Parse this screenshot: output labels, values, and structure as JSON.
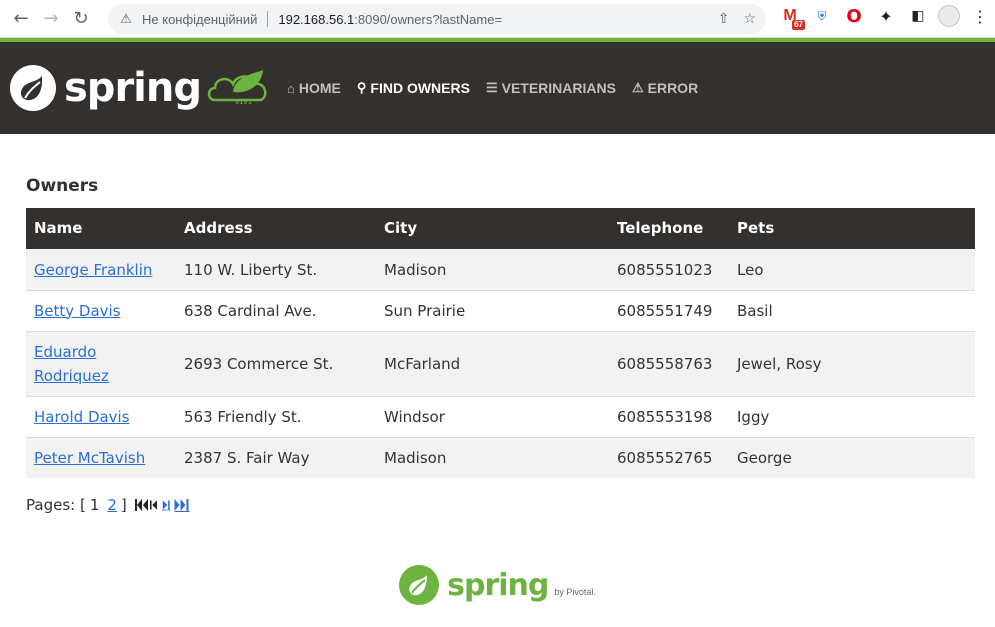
{
  "browser": {
    "security_label": "Не конфіденційний",
    "url_host": "192.168.56.1",
    "url_rest": ":8090/owners?lastName=",
    "gmail_badge": "67"
  },
  "navbar": {
    "brand": "spring",
    "leaf_label": "0101",
    "links": [
      {
        "label": "HOME",
        "icon": "home-icon",
        "active": false
      },
      {
        "label": "FIND OWNERS",
        "icon": "search-icon",
        "active": true
      },
      {
        "label": "VETERINARIANS",
        "icon": "list-icon",
        "active": false
      },
      {
        "label": "ERROR",
        "icon": "warning-icon",
        "active": false
      }
    ]
  },
  "main": {
    "title": "Owners",
    "columns": [
      "Name",
      "Address",
      "City",
      "Telephone",
      "Pets"
    ],
    "rows": [
      {
        "name": "George Franklin",
        "address": "110 W. Liberty St.",
        "city": "Madison",
        "telephone": "6085551023",
        "pets": "Leo"
      },
      {
        "name": "Betty Davis",
        "address": "638 Cardinal Ave.",
        "city": "Sun Prairie",
        "telephone": "6085551749",
        "pets": "Basil"
      },
      {
        "name": "Eduardo Rodriquez",
        "address": "2693 Commerce St.",
        "city": "McFarland",
        "telephone": "6085558763",
        "pets": "Jewel, Rosy"
      },
      {
        "name": "Harold Davis",
        "address": "563 Friendly St.",
        "city": "Windsor",
        "telephone": "6085553198",
        "pets": "Iggy"
      },
      {
        "name": "Peter McTavish",
        "address": "2387 S. Fair Way",
        "city": "Madison",
        "telephone": "6085552765",
        "pets": "George"
      }
    ]
  },
  "pager": {
    "label": "Pages:",
    "open": "[",
    "close": "]",
    "current": "1",
    "other": "2"
  },
  "footer": {
    "brand": "spring",
    "by": "by Pivotal."
  }
}
